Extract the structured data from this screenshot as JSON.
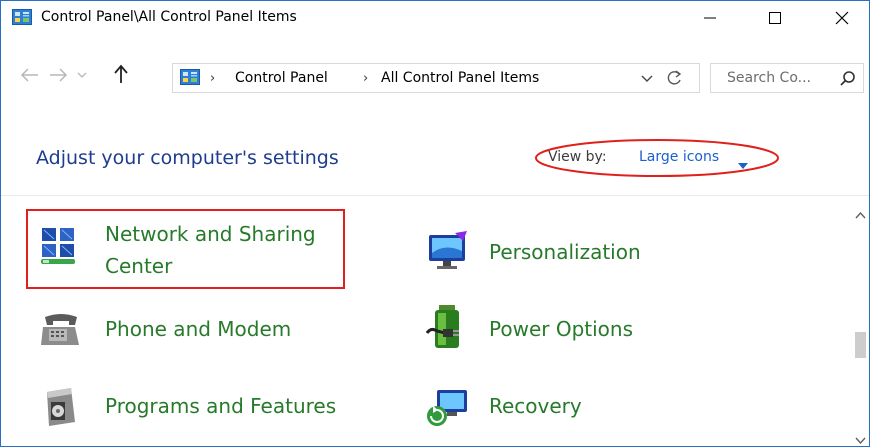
{
  "window": {
    "title": "Control Panel\\All Control Panel Items",
    "icon": "control-panel-icon",
    "controls": [
      "minimize",
      "maximize",
      "close"
    ]
  },
  "nav": {
    "back": "back-arrow-icon",
    "forward": "forward-arrow-icon",
    "recent": "chevron-down-icon",
    "up": "up-arrow-icon"
  },
  "address": {
    "breadcrumb": [
      "Control Panel",
      "All Control Panel Items"
    ],
    "refresh": "refresh-icon"
  },
  "search": {
    "placeholder": "Search Co..."
  },
  "header": {
    "title": "Adjust your computer's settings",
    "view_by_label": "View by:",
    "view_by_value": "Large icons"
  },
  "items": [
    {
      "label_line1": "Network and Sharing",
      "label_line2": "Center",
      "icon": "network-sharing-icon"
    },
    {
      "label": "Personalization",
      "icon": "personalization-icon"
    },
    {
      "label": "Phone and Modem",
      "icon": "phone-modem-icon"
    },
    {
      "label": "Power Options",
      "icon": "power-options-icon"
    },
    {
      "label": "Programs and Features",
      "icon": "programs-features-icon"
    },
    {
      "label": "Recovery",
      "icon": "recovery-icon"
    }
  ],
  "colors": {
    "title_blue": "#1e3d8f",
    "link_blue": "#1b5fd0",
    "item_green": "#277a2a",
    "annotation_red": "#e0201a"
  }
}
